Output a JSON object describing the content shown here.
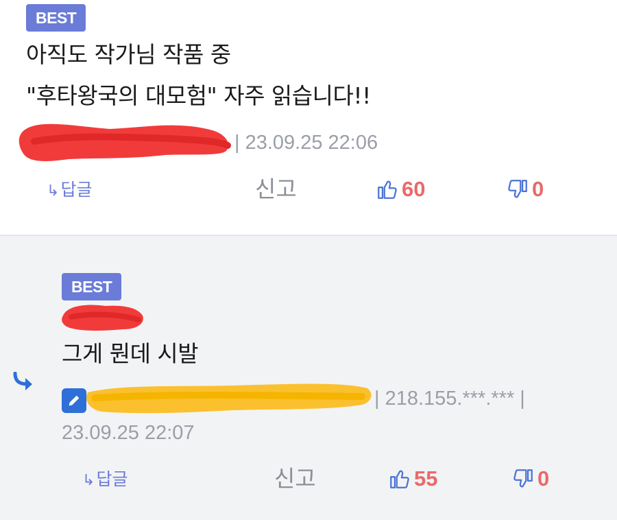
{
  "colors": {
    "badge": "#6b7bd8",
    "like": "#e86a6a",
    "dislike": "#e86a6a",
    "vote_icon": "#4b73d6",
    "reply_link": "#6b7bd8",
    "reply_indicator": "#2f6fd8",
    "edit_icon_bg": "#2f6fd8",
    "redaction_red": "#f13b3b",
    "redaction_yellow": "#fbc02d"
  },
  "comments": [
    {
      "badge": "BEST",
      "lines": [
        "아직도 작가님 작품 중",
        "\"후타왕국의 대모험\" 자주 읽습니다!!"
      ],
      "meta": "| 23.09.25 22:06",
      "actions": {
        "reply_icon": "reply-arrow-icon",
        "reply": "답글",
        "report": "신고",
        "like_icon": "thumbs-up-icon",
        "likes": "60",
        "dislike_icon": "thumbs-down-icon",
        "dislikes": "0"
      }
    },
    {
      "badge": "BEST",
      "lines": [
        "그게 뭔데 시발"
      ],
      "meta": "| 218.155.***.*** |",
      "date": "23.09.25 22:07",
      "author_icon": "pencil-icon",
      "reply_indicator_icon": "reply-arrow-icon",
      "actions": {
        "reply_icon": "reply-arrow-icon",
        "reply": "답글",
        "report": "신고",
        "like_icon": "thumbs-up-icon",
        "likes": "55",
        "dislike_icon": "thumbs-down-icon",
        "dislikes": "0"
      }
    }
  ]
}
